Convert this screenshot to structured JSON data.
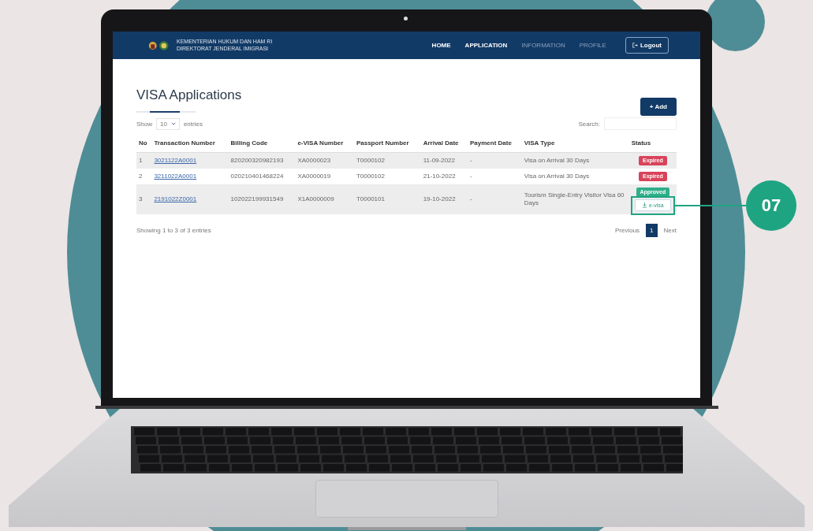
{
  "nav": {
    "org_lines": [
      "KEMENTERIAN HUKUM DAN HAM RI",
      "DIREKTORAT JENDERAL IMIGRASI"
    ],
    "links": [
      {
        "label": "HOME",
        "dimmed": false
      },
      {
        "label": "APPLICATION",
        "dimmed": false
      },
      {
        "label": "INFORMATION",
        "dimmed": true
      },
      {
        "label": "PROFILE",
        "dimmed": true
      }
    ],
    "logout": "Logout"
  },
  "page": {
    "title": "VISA Applications",
    "add_button": "+ Add",
    "show_label": "Show",
    "page_size": "10",
    "entries_label": "entries",
    "search_label": "Search:",
    "columns": [
      "No",
      "Transaction Number",
      "Billing Code",
      "e-VISA Number",
      "Passport Number",
      "Arrival Date",
      "Payment Date",
      "VISA Type",
      "Status"
    ],
    "rows": [
      {
        "cells": [
          "1",
          "3021122A0001",
          "820200320982193",
          "XA0000023",
          "T0000102",
          "11-09-2022",
          "-",
          "Visa on Arrival 30 Days"
        ],
        "status": {
          "kind": "expired",
          "badge": "Expired"
        }
      },
      {
        "cells": [
          "2",
          "3211022A0001",
          "020210401468224",
          "XA0000019",
          "T0000102",
          "21-10-2022",
          "-",
          "Visa on Arrival 30 Days"
        ],
        "status": {
          "kind": "expired",
          "badge": "Expired"
        }
      },
      {
        "cells": [
          "3",
          "2191022Z0001",
          "102022199931549",
          "X1A0000009",
          "T0000101",
          "19-10-2022",
          "-",
          "Tourism Single-Entry Visitor Visa 60 Days"
        ],
        "status": {
          "kind": "approved",
          "badge": "Approved",
          "button": "e-visa"
        }
      }
    ],
    "summary": "Showing 1 to 3 of 3 entries",
    "pagination": {
      "previous": "Previous",
      "pages": [
        {
          "label": "1",
          "selected": true
        }
      ],
      "next": "Next"
    }
  },
  "callout": {
    "label": "07"
  }
}
